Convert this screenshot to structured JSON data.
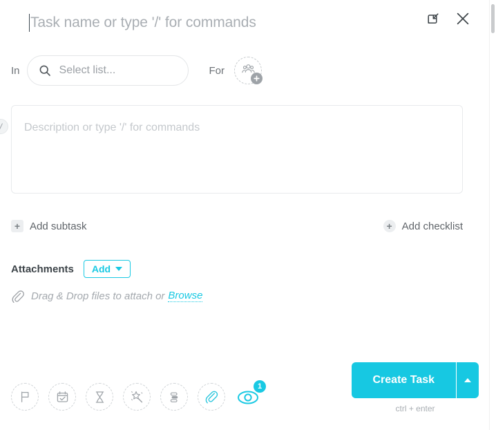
{
  "header": {
    "task_name_placeholder": "Task name or type '/' for commands",
    "task_name_value": "",
    "expand_icon": "open-in-full-icon",
    "close_icon": "close-icon"
  },
  "meta": {
    "in_label": "In",
    "list_placeholder": "Select list...",
    "search_icon": "search-icon",
    "for_label": "For",
    "assignee_icon": "people-group-icon",
    "assignee_badge_icon": "plus-icon"
  },
  "description": {
    "placeholder": "Description or type '/' for commands",
    "value": "",
    "slash_badge": "/"
  },
  "subtasks": {
    "add_subtask_label": "Add subtask",
    "add_checklist_label": "Add checklist",
    "plus_glyph": "+"
  },
  "attachments": {
    "title": "Attachments",
    "add_label": "Add",
    "dropdown_icon": "chevron-down-icon",
    "clip_icon": "paperclip-icon",
    "dragdrop_text": "Drag & Drop files to attach or",
    "browse_label": "Browse"
  },
  "toolbar": {
    "items": [
      {
        "name": "priority-flag-icon",
        "label": "Set priority",
        "active": false,
        "badge": null
      },
      {
        "name": "calendar-check-icon",
        "label": "Set due date",
        "active": false,
        "badge": null
      },
      {
        "name": "hourglass-icon",
        "label": "Time estimate",
        "active": false,
        "badge": null
      },
      {
        "name": "magic-wand-icon",
        "label": "Automations",
        "active": false,
        "badge": null
      },
      {
        "name": "custom-fields-icon",
        "label": "Custom fields",
        "active": false,
        "badge": null
      },
      {
        "name": "paperclip-icon",
        "label": "Attach file",
        "active": false,
        "badge": null
      },
      {
        "name": "eye-watcher-icon",
        "label": "Watchers",
        "active": true,
        "badge": "1"
      }
    ]
  },
  "submit": {
    "label": "Create Task",
    "caret_icon": "chevron-up-icon",
    "shortcut_hint": "ctrl + enter"
  },
  "colors": {
    "accent": "#19c9e3",
    "accent_button": "#17c8e2",
    "text_primary": "#3d4449",
    "text_muted": "#a4a9ae",
    "border": "#e3e5e7"
  }
}
